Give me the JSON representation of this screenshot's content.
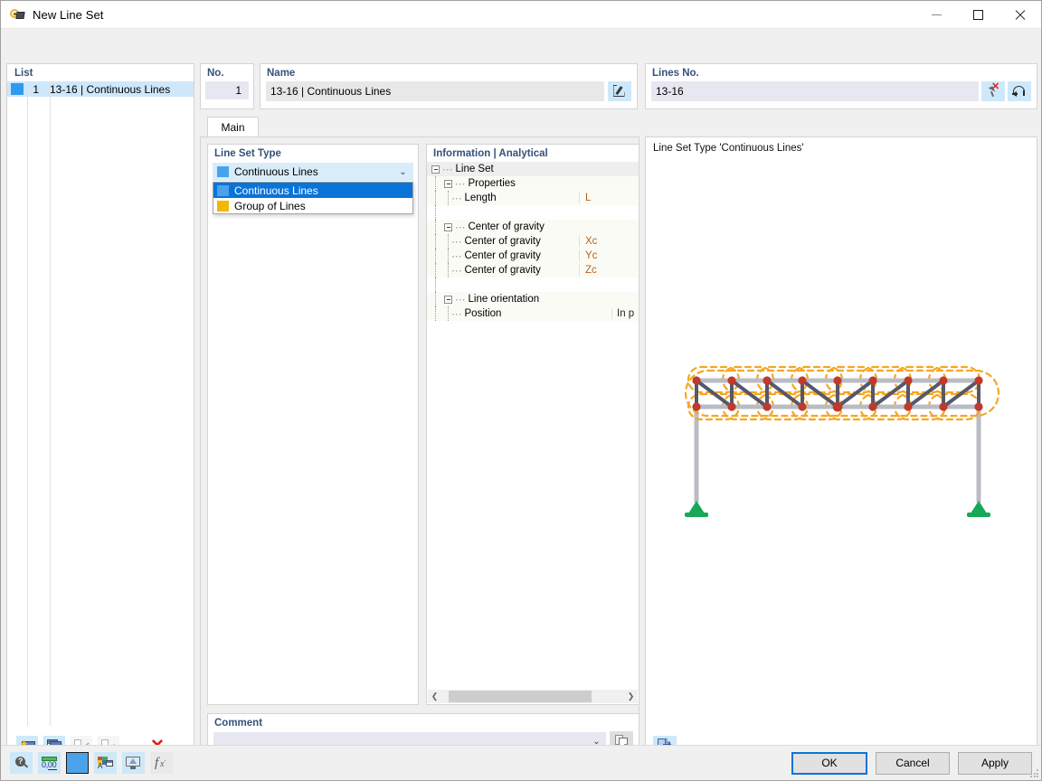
{
  "window": {
    "title": "New Line Set",
    "icon": "line-set-icon",
    "controls": {
      "minimize": "–",
      "maximize": "□",
      "close": "✕"
    }
  },
  "list_panel": {
    "label": "List",
    "rows": [
      {
        "swatch": "#2e9bf0",
        "no": "1",
        "name": "13-16 | Continuous Lines"
      }
    ],
    "toolbar": [
      {
        "name": "new-item-button",
        "icon": "new-window-star-icon",
        "enabled": true
      },
      {
        "name": "copy-item-button",
        "icon": "copy-window-icon",
        "enabled": true
      },
      {
        "name": "select-all-button",
        "icon": "checkbox-check-icon",
        "enabled": false
      },
      {
        "name": "invert-selection-button",
        "icon": "checkbox-swap-icon",
        "enabled": false
      },
      {
        "name": "delete-item-button",
        "icon": "red-x-icon",
        "enabled": true
      }
    ]
  },
  "no_panel": {
    "label": "No.",
    "value": "1"
  },
  "name_panel": {
    "label": "Name",
    "value": "13-16 | Continuous Lines",
    "edit_button_icon": "edit-pencil-icon"
  },
  "lines_panel": {
    "label": "Lines No.",
    "value": "13-16",
    "buttons": [
      {
        "name": "pick-lines-button",
        "icon": "cursor-pick-icon"
      },
      {
        "name": "reset-lines-button",
        "icon": "undo-arrow-icon"
      }
    ]
  },
  "tabs": [
    {
      "label": "Main",
      "active": true
    }
  ],
  "line_set_type": {
    "label": "Line Set Type",
    "selected": "Continuous Lines",
    "selected_swatch": "#4aa3ea",
    "dropdown_open": true,
    "options": [
      {
        "label": "Continuous Lines",
        "swatch": "#4aa3ea",
        "selected": true
      },
      {
        "label": "Group of Lines",
        "swatch": "#f2b705",
        "selected": false
      }
    ]
  },
  "information": {
    "label": "Information | Analytical",
    "rows": [
      {
        "kind": "root",
        "indent": 0,
        "expander": true,
        "label": "Line Set",
        "symbol": "",
        "value": ""
      },
      {
        "kind": "group",
        "indent": 1,
        "expander": true,
        "label": "Properties",
        "symbol": "",
        "value": ""
      },
      {
        "kind": "leaf",
        "indent": 2,
        "expander": false,
        "label": "Length",
        "symbol": "L",
        "value": ""
      },
      {
        "kind": "spacer",
        "indent": 0,
        "expander": false,
        "label": "",
        "symbol": "",
        "value": ""
      },
      {
        "kind": "group",
        "indent": 1,
        "expander": true,
        "label": "Center of gravity",
        "symbol": "",
        "value": ""
      },
      {
        "kind": "leaf",
        "indent": 2,
        "expander": false,
        "label": "Center of gravity",
        "symbol": "Xc",
        "value": ""
      },
      {
        "kind": "leaf",
        "indent": 2,
        "expander": false,
        "label": "Center of gravity",
        "symbol": "Yc",
        "value": ""
      },
      {
        "kind": "leaf",
        "indent": 2,
        "expander": false,
        "label": "Center of gravity",
        "symbol": "Zc",
        "value": ""
      },
      {
        "kind": "spacer",
        "indent": 0,
        "expander": false,
        "label": "",
        "symbol": "",
        "value": ""
      },
      {
        "kind": "group",
        "indent": 1,
        "expander": true,
        "label": "Line orientation",
        "symbol": "",
        "value": ""
      },
      {
        "kind": "leaf",
        "indent": 2,
        "expander": false,
        "label": "Position",
        "symbol": "",
        "value": "In p"
      }
    ],
    "scroll_left_arrow": "❮",
    "scroll_right_arrow": "❯"
  },
  "comment": {
    "label": "Comment",
    "value": "",
    "placeholder": "",
    "chevron": "⌄",
    "copy_button_icon": "copy-pages-icon"
  },
  "viewport": {
    "title": "Line Set Type 'Continuous Lines'",
    "toolbar": [
      {
        "name": "view-orientation-button",
        "icon": "3d-axes-icon"
      }
    ],
    "model": {
      "description": "Planar truss with two columns and pinned supports; top and bottom chords highlighted by orange dashed selection envelope",
      "colors": {
        "chord": "#b9bcc4",
        "web_member": "#55586a",
        "node": "#c0392b",
        "selection": "#f5a623",
        "support": "#17a858",
        "column": "#b9bcc4"
      },
      "node_count_top": 9,
      "node_count_bottom": 9,
      "panels": 8
    }
  },
  "status_icons": [
    {
      "name": "info-query-button",
      "icon": "magnifier-question-icon",
      "state": "active"
    },
    {
      "name": "decimal-places-button",
      "icon": "number-format-icon",
      "state": "active",
      "text": "0,00"
    },
    {
      "name": "color-selector-button",
      "icon": "color-swatch-icon",
      "state": "selected",
      "color": "#4aa3ea"
    },
    {
      "name": "layers-button",
      "icon": "layers-window-icon",
      "state": "active"
    },
    {
      "name": "display-settings-button",
      "icon": "monitor-icon",
      "state": "active"
    },
    {
      "name": "formula-button",
      "icon": "fx-formula-icon",
      "state": "disabled"
    }
  ],
  "dialog_buttons": [
    {
      "label": "OK",
      "name": "ok-button",
      "primary": true
    },
    {
      "label": "Cancel",
      "name": "cancel-button",
      "primary": false
    },
    {
      "label": "Apply",
      "name": "apply-button",
      "primary": false
    }
  ]
}
